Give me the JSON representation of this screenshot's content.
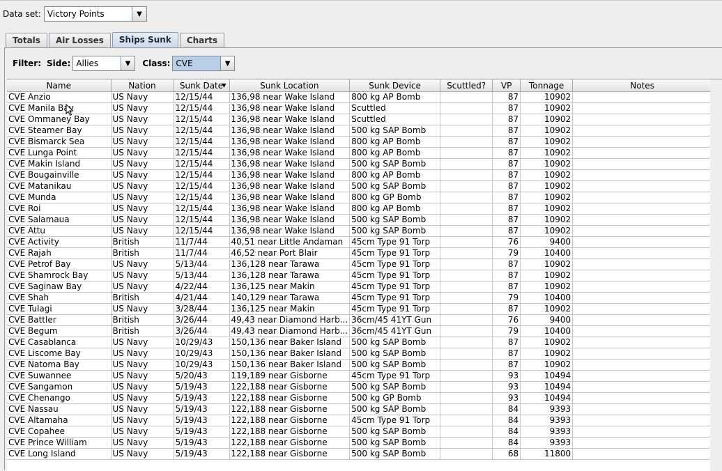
{
  "dataset": {
    "label": "Data set:",
    "value": "Victory Points"
  },
  "tabs": [
    "Totals",
    "Air Losses",
    "Ships Sunk",
    "Charts"
  ],
  "filter": {
    "label": "Filter:",
    "side_label": "Side:",
    "side_value": "Allies",
    "class_label": "Class:",
    "class_value": "CVE"
  },
  "columns": [
    "Name",
    "Nation",
    "Sunk Date",
    "Sunk Location",
    "Sunk Device",
    "Scuttled?",
    "VP",
    "Tonnage",
    "Notes"
  ],
  "rows": [
    [
      "CVE Anzio",
      "US Navy",
      "12/15/44",
      "136,98 near Wake Island",
      "800 kg AP Bomb",
      "",
      "87",
      "10902",
      ""
    ],
    [
      "CVE Manila Bay",
      "US Navy",
      "12/15/44",
      "136,98 near Wake Island",
      "Scuttled",
      "",
      "87",
      "10902",
      ""
    ],
    [
      "CVE Ommaney Bay",
      "US Navy",
      "12/15/44",
      "136,98 near Wake Island",
      "Scuttled",
      "",
      "87",
      "10902",
      ""
    ],
    [
      "CVE Steamer Bay",
      "US Navy",
      "12/15/44",
      "136,98 near Wake Island",
      "500 kg SAP Bomb",
      "",
      "87",
      "10902",
      ""
    ],
    [
      "CVE Bismarck Sea",
      "US Navy",
      "12/15/44",
      "136,98 near Wake Island",
      "800 kg AP Bomb",
      "",
      "87",
      "10902",
      ""
    ],
    [
      "CVE Lunga Point",
      "US Navy",
      "12/15/44",
      "136,98 near Wake Island",
      "800 kg AP Bomb",
      "",
      "87",
      "10902",
      ""
    ],
    [
      "CVE Makin Island",
      "US Navy",
      "12/15/44",
      "136,98 near Wake Island",
      "500 kg SAP Bomb",
      "",
      "87",
      "10902",
      ""
    ],
    [
      "CVE Bougainville",
      "US Navy",
      "12/15/44",
      "136,98 near Wake Island",
      "800 kg AP Bomb",
      "",
      "87",
      "10902",
      ""
    ],
    [
      "CVE Matanikau",
      "US Navy",
      "12/15/44",
      "136,98 near Wake Island",
      "500 kg SAP Bomb",
      "",
      "87",
      "10902",
      ""
    ],
    [
      "CVE Munda",
      "US Navy",
      "12/15/44",
      "136,98 near Wake Island",
      "800 kg GP Bomb",
      "",
      "87",
      "10902",
      ""
    ],
    [
      "CVE Roi",
      "US Navy",
      "12/15/44",
      "136,98 near Wake Island",
      "800 kg AP Bomb",
      "",
      "87",
      "10902",
      ""
    ],
    [
      "CVE Salamaua",
      "US Navy",
      "12/15/44",
      "136,98 near Wake Island",
      "500 kg SAP Bomb",
      "",
      "87",
      "10902",
      ""
    ],
    [
      "CVE Attu",
      "US Navy",
      "12/15/44",
      "136,98 near Wake Island",
      "500 kg SAP Bomb",
      "",
      "87",
      "10902",
      ""
    ],
    [
      "CVE Activity",
      "British",
      "11/7/44",
      "40,51 near Little Andaman",
      "45cm Type 91 Torp",
      "",
      "76",
      "9400",
      ""
    ],
    [
      "CVE Rajah",
      "British",
      "11/7/44",
      "46,52 near Port Blair",
      "45cm Type 91 Torp",
      "",
      "79",
      "10400",
      ""
    ],
    [
      "CVE Petrof Bay",
      "US Navy",
      "5/13/44",
      "136,128 near Tarawa",
      "45cm Type 91 Torp",
      "",
      "87",
      "10902",
      ""
    ],
    [
      "CVE Shamrock Bay",
      "US Navy",
      "5/13/44",
      "136,128 near Tarawa",
      "45cm Type 91 Torp",
      "",
      "87",
      "10902",
      ""
    ],
    [
      "CVE Saginaw Bay",
      "US Navy",
      "4/22/44",
      "136,125 near Makin",
      "45cm Type 91 Torp",
      "",
      "87",
      "10902",
      ""
    ],
    [
      "CVE Shah",
      "British",
      "4/21/44",
      "140,129 near Tarawa",
      "45cm Type 91 Torp",
      "",
      "79",
      "10400",
      ""
    ],
    [
      "CVE Tulagi",
      "US Navy",
      "3/28/44",
      "136,125 near Makin",
      "45cm Type 91 Torp",
      "",
      "87",
      "10902",
      ""
    ],
    [
      "CVE Battler",
      "British",
      "3/26/44",
      "49,43 near Diamond Harb...",
      "36cm/45 41YT Gun",
      "",
      "76",
      "9400",
      ""
    ],
    [
      "CVE Begum",
      "British",
      "3/26/44",
      "49,43 near Diamond Harb...",
      "36cm/45 41YT Gun",
      "",
      "79",
      "10400",
      ""
    ],
    [
      "CVE Casablanca",
      "US Navy",
      "10/29/43",
      "150,136 near Baker Island",
      "500 kg SAP Bomb",
      "",
      "87",
      "10902",
      ""
    ],
    [
      "CVE Liscome Bay",
      "US Navy",
      "10/29/43",
      "150,136 near Baker Island",
      "500 kg SAP Bomb",
      "",
      "87",
      "10902",
      ""
    ],
    [
      "CVE Natoma Bay",
      "US Navy",
      "10/29/43",
      "150,136 near Baker Island",
      "500 kg SAP Bomb",
      "",
      "87",
      "10902",
      ""
    ],
    [
      "CVE Suwannee",
      "US Navy",
      "5/20/43",
      "119,189 near Gisborne",
      "45cm Type 91 Torp",
      "",
      "93",
      "10494",
      ""
    ],
    [
      "CVE Sangamon",
      "US Navy",
      "5/19/43",
      "122,188 near Gisborne",
      "500 kg SAP Bomb",
      "",
      "93",
      "10494",
      ""
    ],
    [
      "CVE Chenango",
      "US Navy",
      "5/19/43",
      "122,188 near Gisborne",
      "500 kg GP Bomb",
      "",
      "93",
      "10494",
      ""
    ],
    [
      "CVE Nassau",
      "US Navy",
      "5/19/43",
      "122,188 near Gisborne",
      "500 kg SAP Bomb",
      "",
      "84",
      "9393",
      ""
    ],
    [
      "CVE Altamaha",
      "US Navy",
      "5/19/43",
      "122,188 near Gisborne",
      "45cm Type 91 Torp",
      "",
      "84",
      "9393",
      ""
    ],
    [
      "CVE Copahee",
      "US Navy",
      "5/19/43",
      "122,188 near Gisborne",
      "500 kg SAP Bomb",
      "",
      "84",
      "9393",
      ""
    ],
    [
      "CVE Prince William",
      "US Navy",
      "5/19/43",
      "122,188 near Gisborne",
      "500 kg SAP Bomb",
      "",
      "84",
      "9393",
      ""
    ],
    [
      "CVE Long Island",
      "US Navy",
      "5/19/43",
      "122,188 near Gisborne",
      "500 kg SAP Bomb",
      "",
      "68",
      "11800",
      ""
    ]
  ]
}
